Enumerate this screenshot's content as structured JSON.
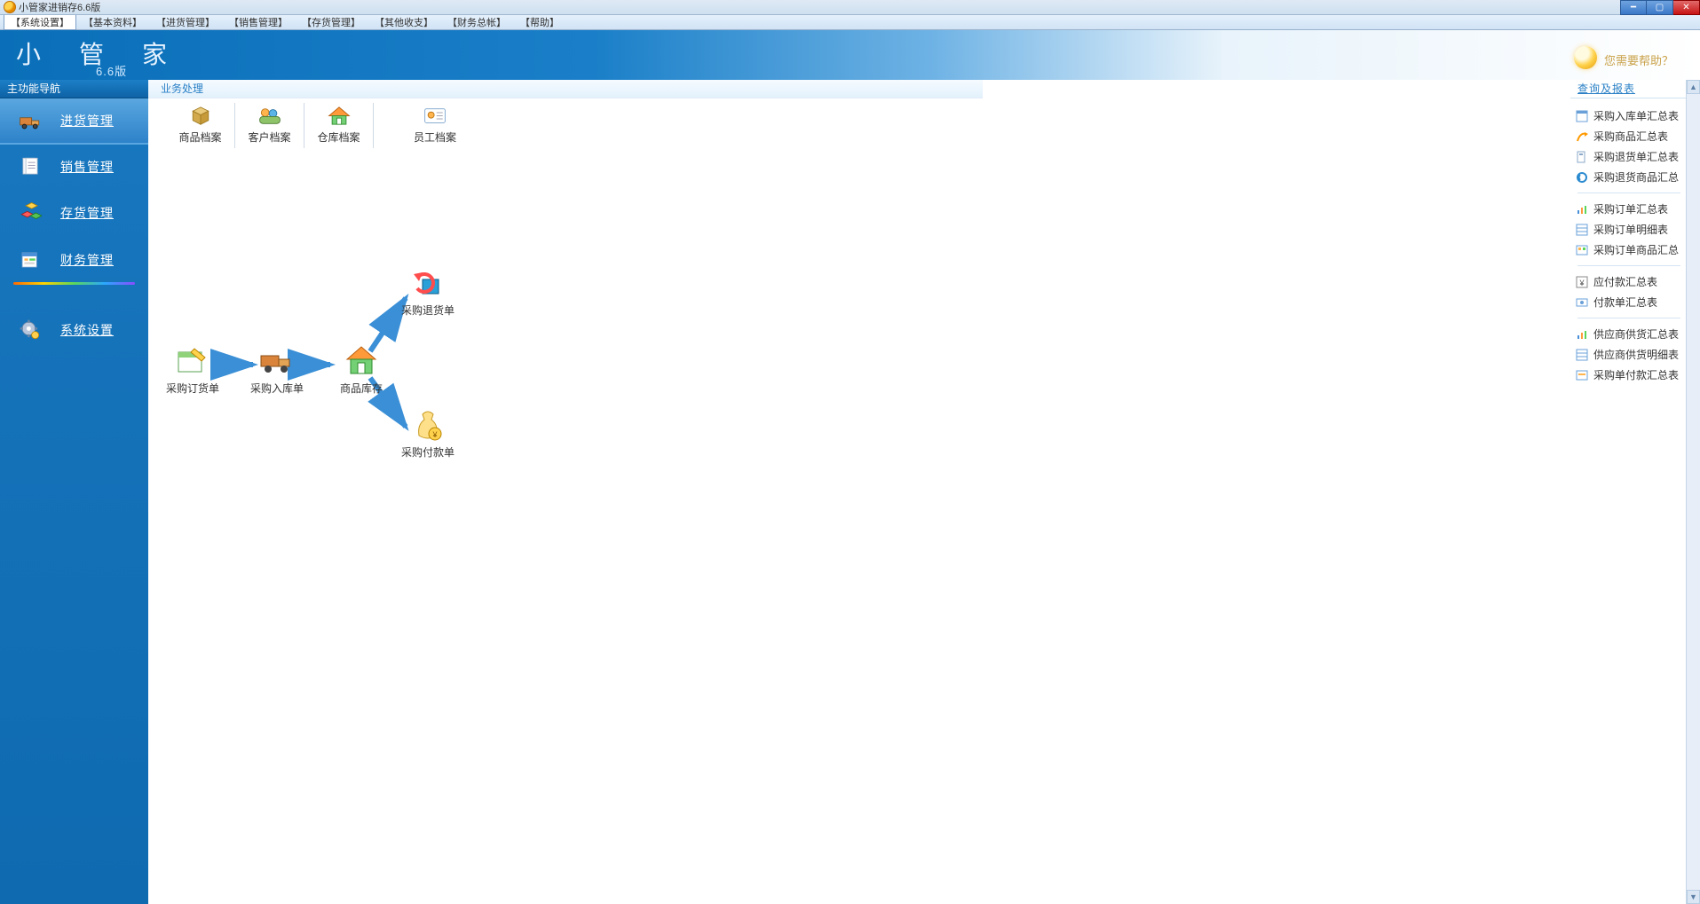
{
  "window": {
    "title": "小管家进销存6.6版"
  },
  "menubar": [
    "【系统设置】",
    "【基本资料】",
    "【进货管理】",
    "【销售管理】",
    "【存货管理】",
    "【其他收支】",
    "【财务总帐】",
    "【帮助】"
  ],
  "banner": {
    "title": "小 管 家",
    "version": "6.6版",
    "help": "您需要帮助？"
  },
  "left_nav": {
    "title": "主功能导航",
    "items": [
      {
        "label": "进货管理",
        "icon": "truck"
      },
      {
        "label": "销售管理",
        "icon": "document"
      },
      {
        "label": "存货管理",
        "icon": "cubes"
      },
      {
        "label": "财务管理",
        "icon": "ledger"
      },
      {
        "label": "系统设置",
        "icon": "gear"
      }
    ]
  },
  "center": {
    "title": "业务处理",
    "toolbar": [
      {
        "label": "商品档案",
        "icon": "box"
      },
      {
        "label": "客户档案",
        "icon": "people"
      },
      {
        "label": "仓库档案",
        "icon": "house"
      },
      {
        "label": "员工档案",
        "icon": "idcard"
      }
    ],
    "flow_nodes": {
      "order": {
        "label": "采购订货单"
      },
      "in": {
        "label": "采购入库单"
      },
      "stock": {
        "label": "商品库存"
      },
      "return": {
        "label": "采购退货单"
      },
      "pay": {
        "label": "采购付款单"
      }
    }
  },
  "right": {
    "title": "查询及报表",
    "groups": [
      [
        "采购入库单汇总表",
        "采购商品汇总表",
        "采购退货单汇总表",
        "采购退货商品汇总"
      ],
      [
        "采购订单汇总表",
        "采购订单明细表",
        "采购订单商品汇总"
      ],
      [
        "应付款汇总表",
        "付款单汇总表"
      ],
      [
        "供应商供货汇总表",
        "供应商供货明细表",
        "采购单付款汇总表"
      ]
    ]
  }
}
